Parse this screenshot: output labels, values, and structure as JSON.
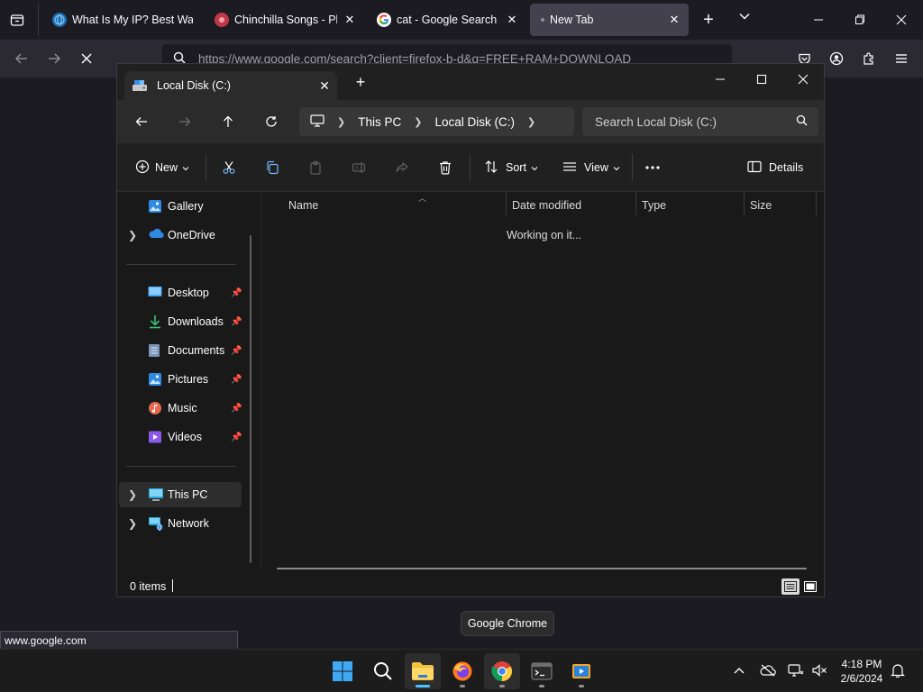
{
  "firefox": {
    "tabs": [
      {
        "title": "What Is My IP? Best Way",
        "icon": "globe"
      },
      {
        "title": "Chinchilla Songs - Play",
        "icon": "music"
      },
      {
        "title": "cat - Google Search",
        "icon": "google"
      },
      {
        "title": "New Tab",
        "icon": "dot"
      }
    ],
    "url": "https://www.google.com/search?client=firefox-b-d&q=FREE+RAM+DOWNLOAD",
    "status_link": "www.google.com"
  },
  "tooltip": "Google Chrome",
  "explorer": {
    "tab_title": "Local Disk (C:)",
    "breadcrumb": [
      "This PC",
      "Local Disk (C:)"
    ],
    "search_placeholder": "Search Local Disk (C:)",
    "commands": {
      "new": "New",
      "sort": "Sort",
      "view": "View",
      "details": "Details"
    },
    "nav": {
      "gallery": "Gallery",
      "onedrive": "OneDrive",
      "desktop": "Desktop",
      "downloads": "Downloads",
      "documents": "Documents",
      "pictures": "Pictures",
      "music": "Music",
      "videos": "Videos",
      "this_pc": "This PC",
      "network": "Network"
    },
    "columns": [
      "Name",
      "Date modified",
      "Type",
      "Size"
    ],
    "empty_message": "Working on it...",
    "status_count": "0 items"
  },
  "taskbar": {
    "time": "4:18 PM",
    "date": "2/6/2024"
  }
}
